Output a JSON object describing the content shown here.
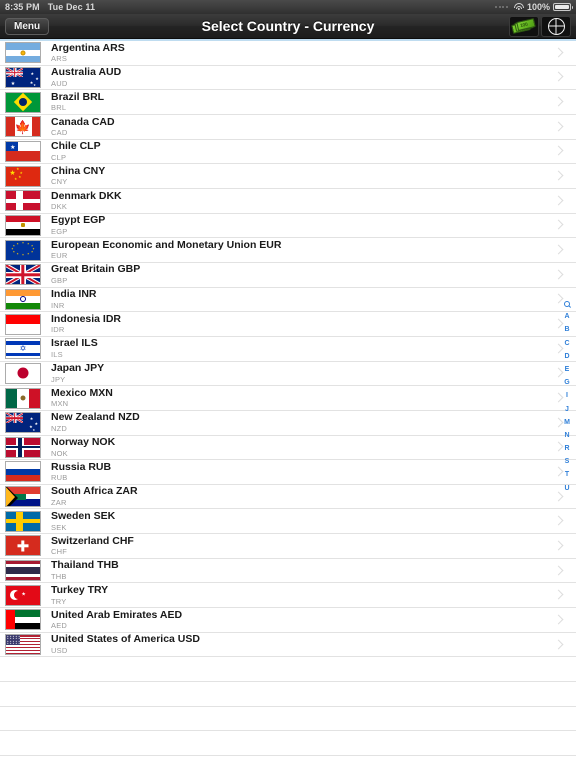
{
  "status_bar": {
    "time": "8:35 PM",
    "date": "Tue Dec 11",
    "battery_percent": "100%",
    "wifi_icon": "wifi-icon",
    "battery_icon": "battery-icon"
  },
  "nav_bar": {
    "menu_label": "Menu",
    "title": "Select Country - Currency",
    "money_icon": "banknote-icon",
    "globe_icon": "globe-icon"
  },
  "index_bar": {
    "search_icon": "search-icon",
    "letters": [
      "A",
      "B",
      "C",
      "D",
      "E",
      "G",
      "I",
      "J",
      "M",
      "N",
      "R",
      "S",
      "T",
      "U"
    ],
    "color": "#2f7fd8"
  },
  "list": {
    "rows": [
      {
        "name": "Argentina ARS",
        "code": "ARS",
        "flag": "ar"
      },
      {
        "name": "Australia AUD",
        "code": "AUD",
        "flag": "au"
      },
      {
        "name": "Brazil BRL",
        "code": "BRL",
        "flag": "br"
      },
      {
        "name": "Canada CAD",
        "code": "CAD",
        "flag": "ca"
      },
      {
        "name": "Chile CLP",
        "code": "CLP",
        "flag": "cl"
      },
      {
        "name": "China CNY",
        "code": "CNY",
        "flag": "cn"
      },
      {
        "name": "Denmark DKK",
        "code": "DKK",
        "flag": "dk"
      },
      {
        "name": "Egypt EGP",
        "code": "EGP",
        "flag": "eg"
      },
      {
        "name": "European Economic and Monetary Union EUR",
        "code": "EUR",
        "flag": "eu"
      },
      {
        "name": "Great Britain GBP",
        "code": "GBP",
        "flag": "gb"
      },
      {
        "name": "India INR",
        "code": "INR",
        "flag": "in"
      },
      {
        "name": "Indonesia IDR",
        "code": "IDR",
        "flag": "id"
      },
      {
        "name": "Israel ILS",
        "code": "ILS",
        "flag": "il"
      },
      {
        "name": "Japan JPY",
        "code": "JPY",
        "flag": "jp"
      },
      {
        "name": "Mexico MXN",
        "code": "MXN",
        "flag": "mx"
      },
      {
        "name": "New Zealand NZD",
        "code": "NZD",
        "flag": "nz"
      },
      {
        "name": "Norway NOK",
        "code": "NOK",
        "flag": "no"
      },
      {
        "name": "Russia RUB",
        "code": "RUB",
        "flag": "ru"
      },
      {
        "name": "South Africa ZAR",
        "code": "ZAR",
        "flag": "za"
      },
      {
        "name": "Sweden SEK",
        "code": "SEK",
        "flag": "se"
      },
      {
        "name": "Switzerland CHF",
        "code": "CHF",
        "flag": "ch"
      },
      {
        "name": "Thailand THB",
        "code": "THB",
        "flag": "th"
      },
      {
        "name": "Turkey TRY",
        "code": "TRY",
        "flag": "tr"
      },
      {
        "name": "United Arab Emirates AED",
        "code": "AED",
        "flag": "ae"
      },
      {
        "name": "United States of America USD",
        "code": "USD",
        "flag": "us"
      }
    ],
    "empty_row_count": 4,
    "chevron_icon": "chevron-right-icon"
  }
}
